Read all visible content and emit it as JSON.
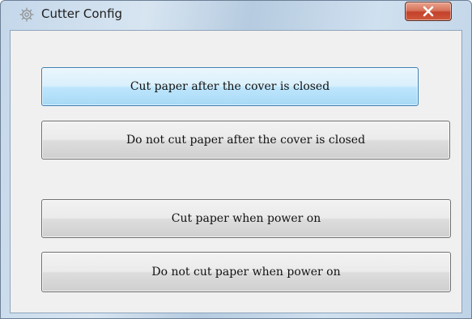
{
  "window": {
    "title": "Cutter Config",
    "title_icon": "gear-icon",
    "close_icon": "close-x-icon"
  },
  "buttons": [
    {
      "label": "Cut paper after the cover is closed",
      "focused": true
    },
    {
      "label": "Do not cut paper after the cover is closed",
      "focused": false
    },
    {
      "label": "Cut paper when power on",
      "focused": false
    },
    {
      "label": "Do not cut paper when power on",
      "focused": false
    }
  ],
  "colors": {
    "titlebar": "#c4d7ea",
    "client_bg": "#f0f0f0",
    "close_button": "#c3412a",
    "focused_button_border": "#3c7fb1"
  }
}
